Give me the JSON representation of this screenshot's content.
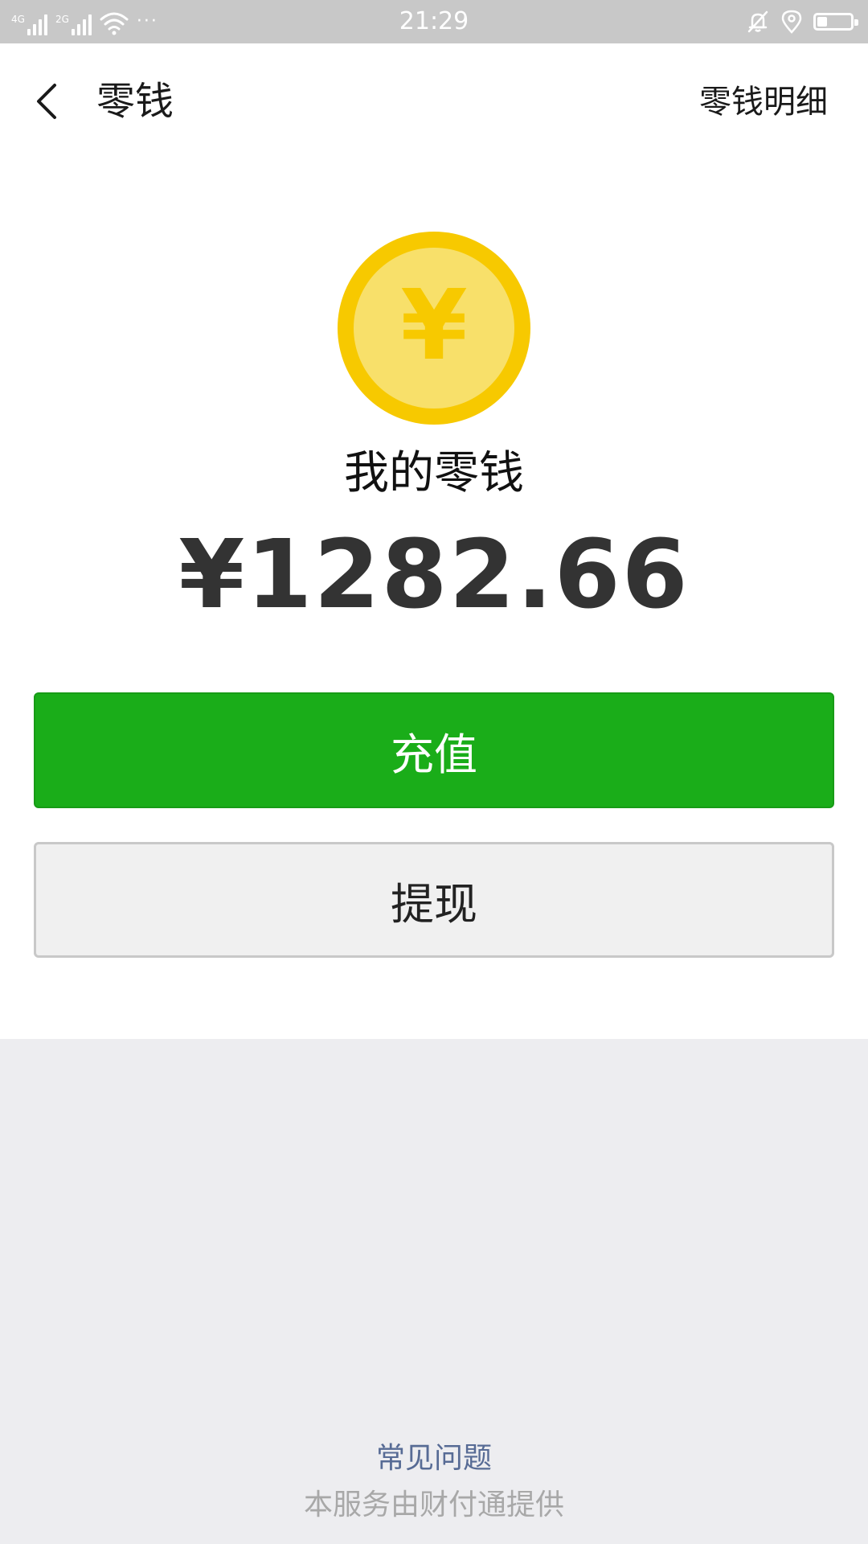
{
  "status_bar": {
    "network_1": "4G",
    "network_2": "2G",
    "more_dots": "···",
    "time": "21:29",
    "battery_level": 0.3
  },
  "header": {
    "back_icon": "chevron-left-icon",
    "title": "零钱",
    "details_link": "零钱明细"
  },
  "balance": {
    "coin_icon": "yuan-coin-icon",
    "coin_symbol": "¥",
    "label": "我的零钱",
    "amount": "¥1282.66"
  },
  "actions": {
    "recharge_label": "充值",
    "withdraw_label": "提现"
  },
  "footer": {
    "faq_link": "常见问题",
    "provider_note": "本服务由财付通提供"
  },
  "colors": {
    "primary_green": "#1aad19",
    "link_blue": "#576b95",
    "coin_outer": "#f7c900",
    "coin_inner": "#f8e06a",
    "page_gray": "#ededf0"
  }
}
